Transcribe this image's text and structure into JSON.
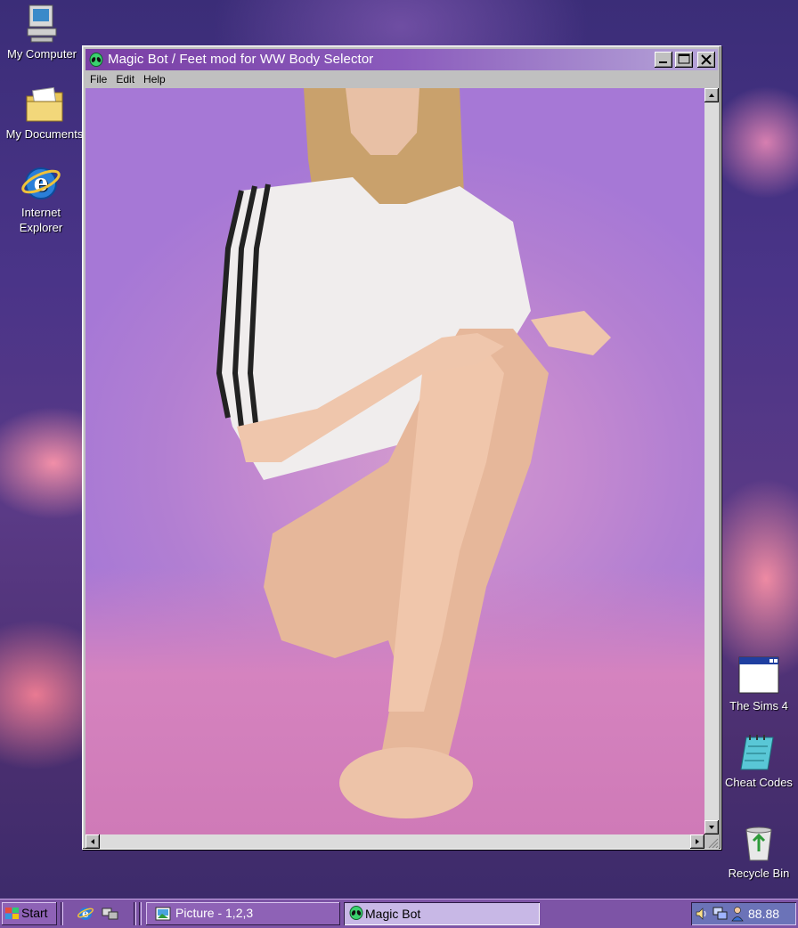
{
  "desktop": {
    "icons": [
      {
        "label": "My Computer"
      },
      {
        "label": "My Documents"
      },
      {
        "label": "Internet Explorer"
      },
      {
        "label": "The Sims 4"
      },
      {
        "label": "Cheat Codes"
      },
      {
        "label": "Recycle Bin"
      }
    ]
  },
  "window": {
    "title": "Magic Bot / Feet mod for WW Body Selector",
    "title_icon": "alien-head-icon",
    "menu": [
      "File",
      "Edit",
      "Help"
    ],
    "content": "image"
  },
  "taskbar": {
    "start_label": "Start",
    "quick_launch": [
      "internet-explorer-icon",
      "show-desktop-icon"
    ],
    "tasks": [
      {
        "label": "Picture - 1,2,3",
        "icon": "picture-icon",
        "active": false
      },
      {
        "label": "Magic Bot",
        "icon": "alien-head-icon",
        "active": true
      }
    ],
    "tray_time": "88.88",
    "tray_icons": [
      "volume-icon",
      "network-icon",
      "user-icon"
    ]
  },
  "colors": {
    "title_start": "#7a3fa5",
    "title_end": "#b7a6d9",
    "taskbar": "#7d54a6"
  }
}
